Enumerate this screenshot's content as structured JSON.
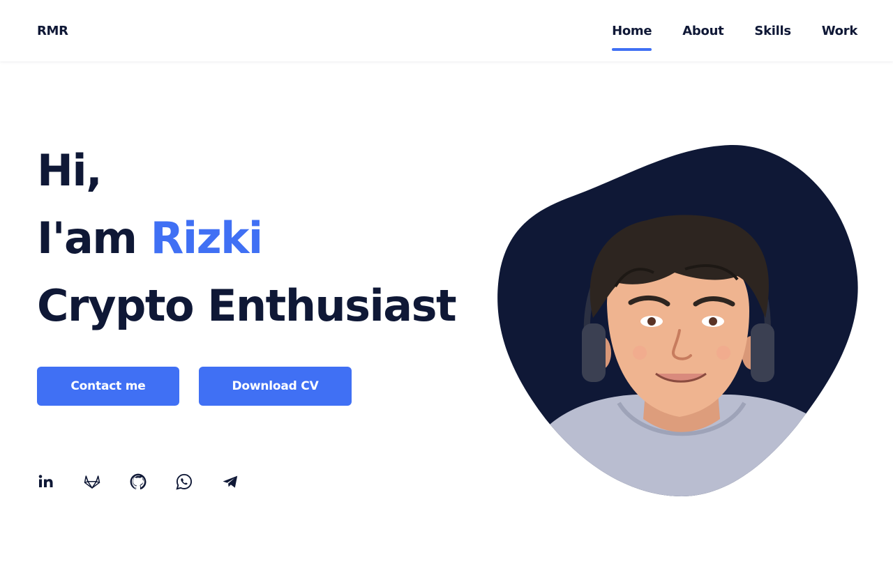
{
  "header": {
    "logo": "RMR",
    "nav": [
      {
        "label": "Home",
        "active": true
      },
      {
        "label": "About",
        "active": false
      },
      {
        "label": "Skills",
        "active": false
      },
      {
        "label": "Work",
        "active": false
      }
    ]
  },
  "hero": {
    "greeting": "Hi,",
    "intro_prefix": "I'am",
    "name": "Rizki",
    "role": "Crypto Enthusiast"
  },
  "buttons": {
    "contact": "Contact me",
    "download": "Download CV"
  },
  "social": [
    {
      "icon": "linkedin-icon"
    },
    {
      "icon": "gitlab-icon"
    },
    {
      "icon": "github-icon"
    },
    {
      "icon": "whatsapp-icon"
    },
    {
      "icon": "telegram-icon"
    }
  ],
  "colors": {
    "primary_dark": "#0f1836",
    "accent": "#4070f4",
    "background": "#ffffff",
    "blob": "#0f1836"
  }
}
